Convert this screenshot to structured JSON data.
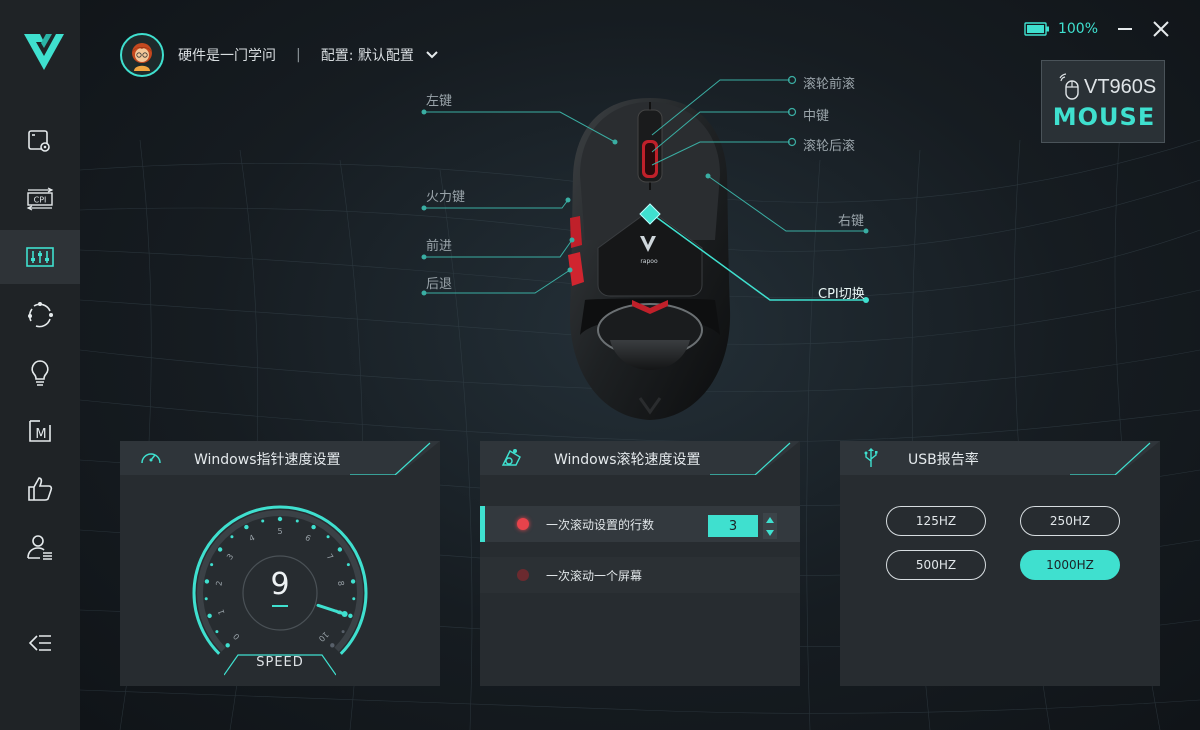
{
  "header": {
    "user_name": "硬件是一门学问",
    "separator": "|",
    "profile_label": "配置: 默认配置"
  },
  "window": {
    "battery_percent": "100%"
  },
  "device": {
    "model": "VT960S",
    "type": "MOUSE"
  },
  "mouse_buttons": {
    "left": "左键",
    "fire": "火力键",
    "forward": "前进",
    "back": "后退",
    "scroll_up": "滚轮前滚",
    "middle": "中键",
    "scroll_down": "滚轮后滚",
    "right": "右键",
    "cpi": "CPI切换",
    "brand": "rapoo"
  },
  "sidebar": {
    "items": [
      {
        "icon": "screen-gear-icon"
      },
      {
        "icon": "cpi-icon",
        "label": "CPI"
      },
      {
        "icon": "equalizer-icon",
        "active": true
      },
      {
        "icon": "cycle-icon"
      },
      {
        "icon": "lightbulb-icon"
      },
      {
        "icon": "macro-icon",
        "label": "M"
      },
      {
        "icon": "thumbs-up-icon"
      },
      {
        "icon": "user-settings-icon"
      },
      {
        "icon": "collapse-menu-icon"
      }
    ]
  },
  "pointer_panel": {
    "title": "Windows指针速度设置",
    "speed_value": "9",
    "speed_label": "SPEED",
    "ticks": [
      "0",
      "1",
      "2",
      "3",
      "4",
      "5",
      "6",
      "7",
      "8",
      "9",
      "10"
    ],
    "speed": 9,
    "max": 10
  },
  "scroll_panel": {
    "title": "Windows滚轮速度设置",
    "option_lines": "一次滚动设置的行数",
    "lines_value": "3",
    "option_screen": "一次滚动一个屏幕"
  },
  "usb_panel": {
    "title": "USB报告率",
    "options": [
      "125HZ",
      "250HZ",
      "500HZ",
      "1000HZ"
    ],
    "selected": "1000HZ"
  },
  "colors": {
    "accent": "#3fe0cf",
    "red": "#e7434b",
    "sidebar_bg": "#1f2326",
    "panel_bg": "#272c30"
  }
}
